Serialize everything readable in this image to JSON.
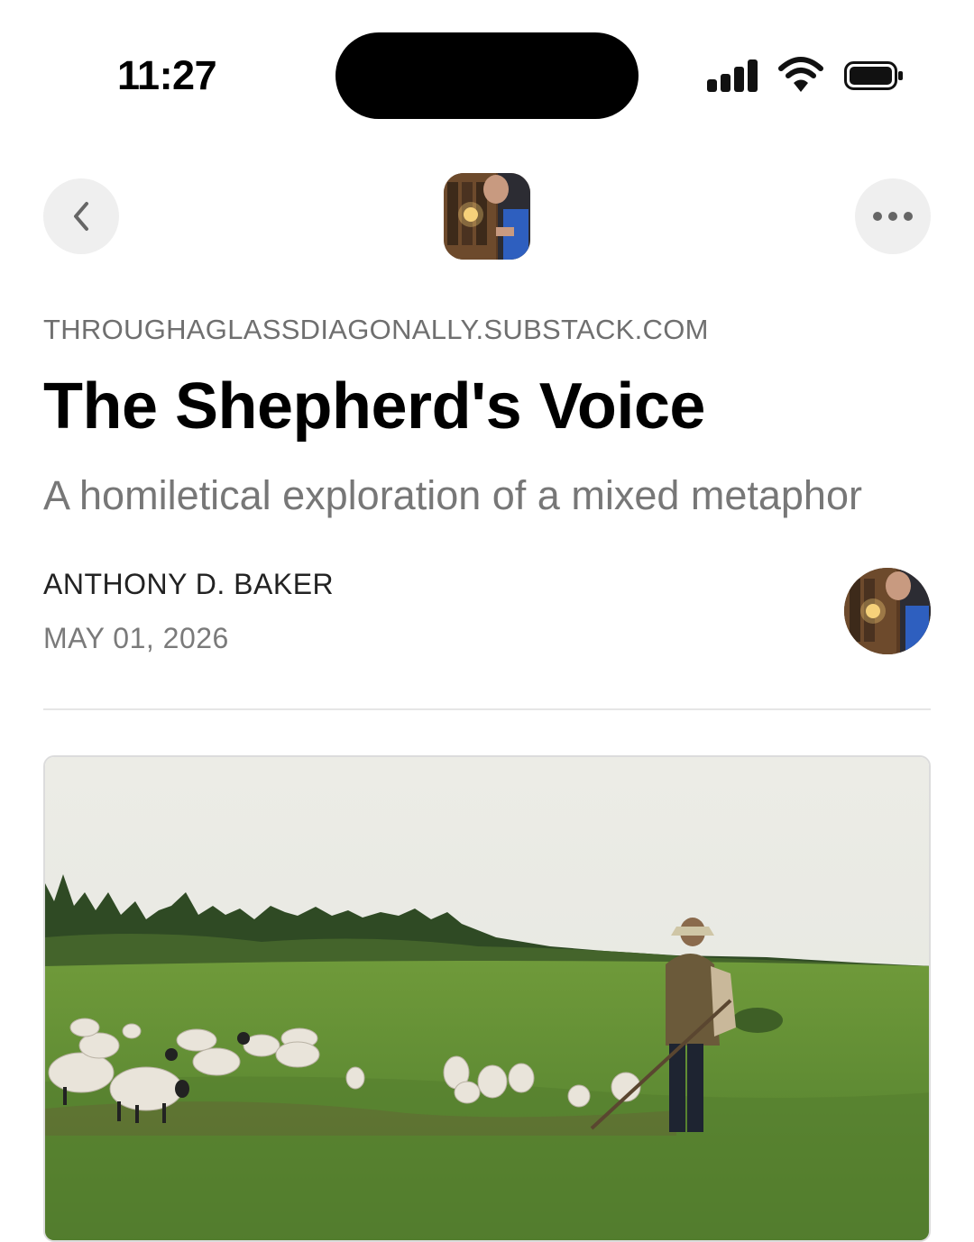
{
  "status_bar": {
    "time": "11:27",
    "icons": [
      "signal-icon",
      "wifi-icon",
      "battery-icon"
    ]
  },
  "nav": {
    "back_icon": "chevron-left-icon",
    "more_icon": "more-horizontal-icon"
  },
  "article": {
    "publication_domain": "THROUGHAGLASSDIAGONALLY.SUBSTACK.COM",
    "title": "The Shepherd's Voice",
    "subtitle": "A homiletical exploration of a mixed metaphor",
    "author": "ANTHONY D. BAKER",
    "date": "MAY 01, 2026"
  },
  "colors": {
    "text_primary": "#000000",
    "text_secondary": "#777777",
    "button_bg": "#efefef",
    "divider": "#e6e6e6"
  }
}
